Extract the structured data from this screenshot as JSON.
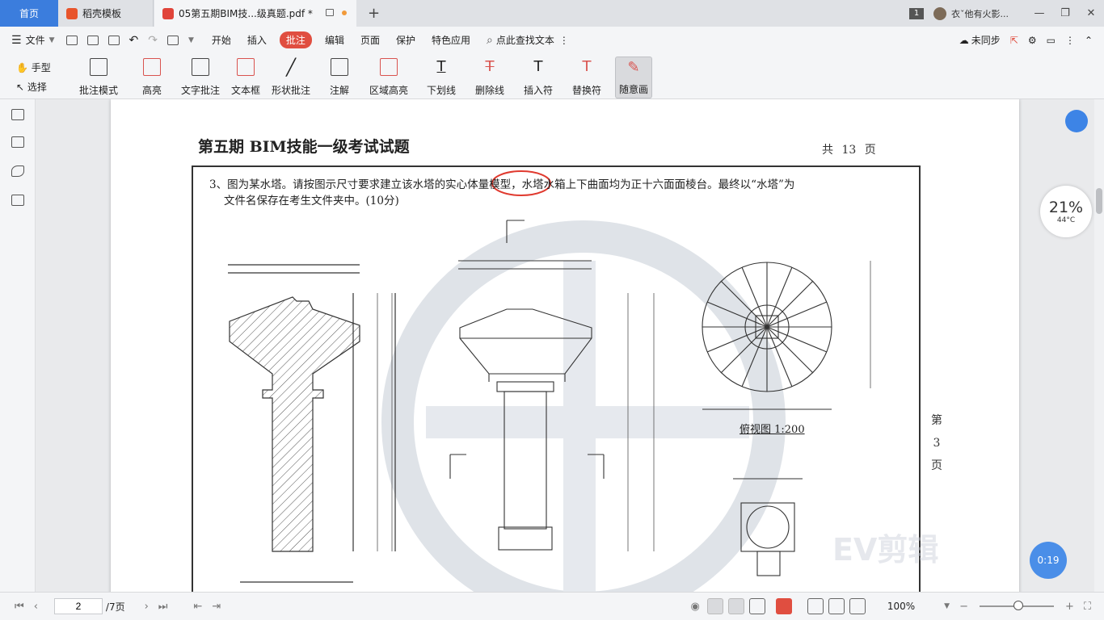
{
  "tabs": {
    "home": "首页",
    "template": "稻壳模板",
    "document": "05第五期BIM技...级真题.pdf *",
    "new_tab": "+"
  },
  "titlebar": {
    "window_count": "1",
    "user": "衣ˇ他有火影..."
  },
  "menu": {
    "file": "文件",
    "items": [
      "开始",
      "插入",
      "批注",
      "编辑",
      "页面",
      "保护",
      "特色应用"
    ],
    "active": "批注",
    "search": "点此查找文本",
    "sync": "未同步"
  },
  "ribbon": {
    "hand": "手型",
    "select": "选择",
    "tools": [
      "批注模式",
      "高亮",
      "文字批注",
      "文本框",
      "形状批注",
      "注解",
      "区域高亮",
      "下划线",
      "删除线",
      "插入符",
      "替换符",
      "随意画"
    ]
  },
  "document": {
    "title": "第五期 BIM技能一级考试试题",
    "total_pages": "共 13 页",
    "question_line1": "3、图为某水塔。请按图示尺寸要求建立该水塔的实心体量模型，水塔水箱上下曲面均为正十六面面棱台。最终以“水塔”为",
    "question_line2": "文件名保存在考生文件夹中。(10分)",
    "page_side": [
      "第",
      "3",
      "页"
    ],
    "plan_caption": "俯视图   1:200"
  },
  "widgets": {
    "gauge_value": "21%",
    "gauge_temp": "44°C",
    "timer": "0:19",
    "watermark": "EV剪辑"
  },
  "statusbar": {
    "current_page": "2",
    "total_pages": "/7页",
    "zoom": "100%"
  }
}
